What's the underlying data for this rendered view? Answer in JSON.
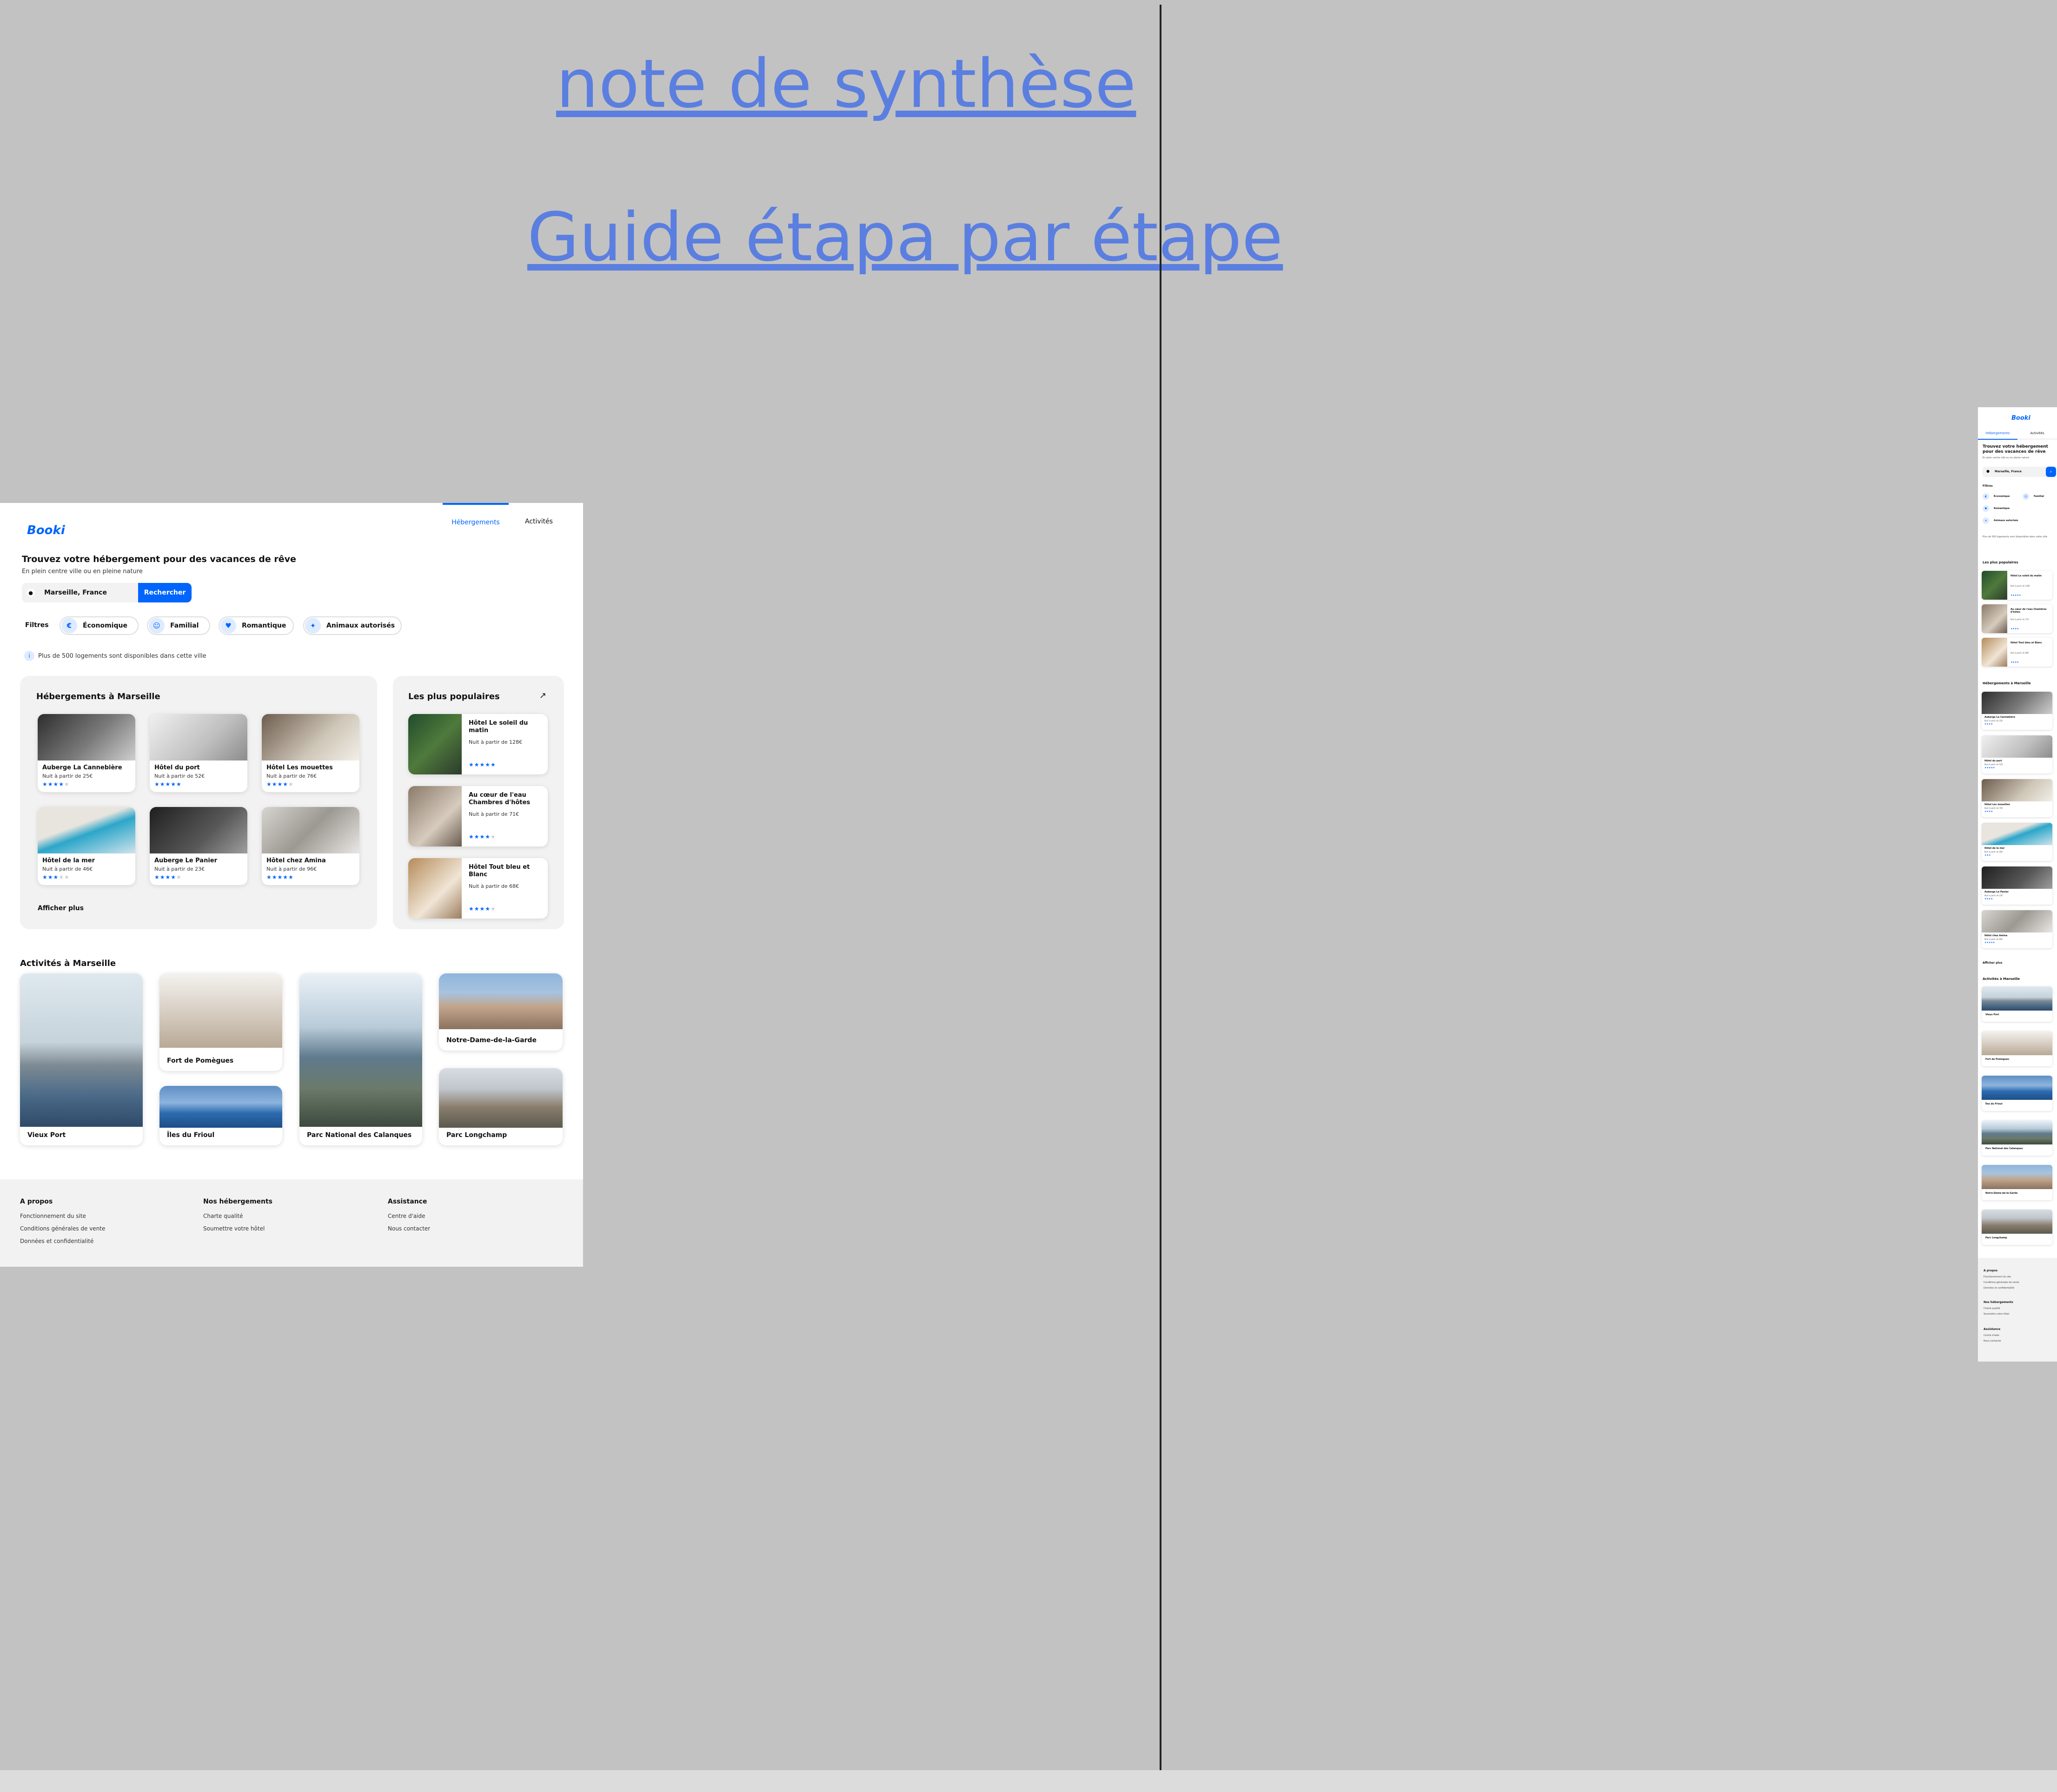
{
  "links": {
    "summary": "note de synthèse",
    "guide": "Guide étapa par étape"
  },
  "brand": {
    "logo": "Booki",
    "accent_color": "#0065fc"
  },
  "nav": {
    "tab_lodging": "Hébergements",
    "tab_activities": "Activités"
  },
  "hero": {
    "title": "Trouvez votre hébergement pour des vacances de rêve",
    "subtitle": "En plein centre ville ou en pleine nature",
    "search_value": "Marseille, France",
    "search_button": "Rechercher"
  },
  "filters": {
    "label": "Filtres",
    "items": [
      {
        "label": "Économique",
        "icon": "money-icon"
      },
      {
        "label": "Familial",
        "icon": "child-icon"
      },
      {
        "label": "Romantique",
        "icon": "heart-icon"
      },
      {
        "label": "Animaux autorisés",
        "icon": "dog-icon"
      }
    ]
  },
  "info": "Plus de 500 logements sont disponibles dans cette ville",
  "lodging": {
    "title": "Hébergements à Marseille",
    "show_more": "Afficher plus",
    "items": [
      {
        "name": "Auberge La Cannebière",
        "price": "Nuit à partir de 25€",
        "rating": 4
      },
      {
        "name": "Hôtel du port",
        "price": "Nuit à partir de 52€",
        "rating": 5
      },
      {
        "name": "Hôtel Les mouettes",
        "price": "Nuit à partir de 76€",
        "rating": 4
      },
      {
        "name": "Hôtel de la mer",
        "price": "Nuit à partir de 46€",
        "rating": 3
      },
      {
        "name": "Auberge Le Panier",
        "price": "Nuit à partir de 23€",
        "rating": 4
      },
      {
        "name": "Hôtel chez Amina",
        "price": "Nuit à partir de 96€",
        "rating": 5
      }
    ]
  },
  "popular": {
    "title": "Les plus populaires",
    "items": [
      {
        "name": "Hôtel Le soleil du matin",
        "price": "Nuit à partir de 128€",
        "rating": 5
      },
      {
        "name": "Au cœur de l'eau Chambres d'hôtes",
        "price": "Nuit à partir de 71€",
        "rating": 4
      },
      {
        "name": "Hôtel Tout bleu et Blanc",
        "price": "Nuit à partir de 68€",
        "rating": 4
      }
    ]
  },
  "activities": {
    "title": "Activités à Marseille",
    "items": [
      "Vieux Port",
      "Fort de Pomègues",
      "Îles du Frioul",
      "Parc National des Calanques",
      "Notre-Dame-de-la-Garde",
      "Parc Longchamp"
    ]
  },
  "footer": {
    "cols": [
      {
        "title": "A propos",
        "links": [
          "Fonctionnement du site",
          "Conditions générales de vente",
          "Données et confidentialité"
        ]
      },
      {
        "title": "Nos hébergements",
        "links": [
          "Charte qualité",
          "Soumettre votre hôtel"
        ]
      },
      {
        "title": "Assistance",
        "links": [
          "Centre d'aide",
          "Nous contacter"
        ]
      }
    ]
  }
}
